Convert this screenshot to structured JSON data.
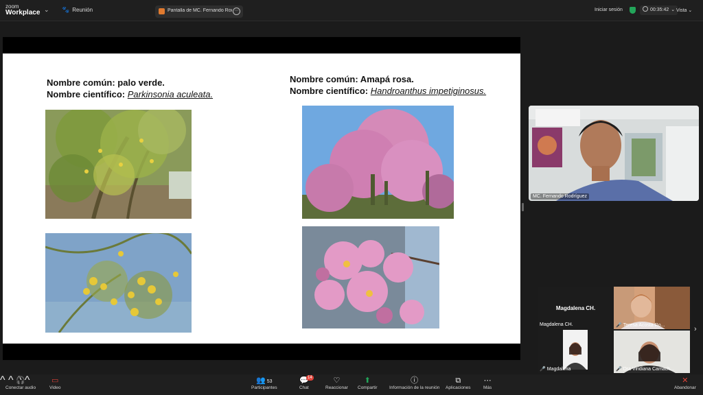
{
  "topbar": {
    "logo_line1": "zoom",
    "logo_line2": "Workplace",
    "meeting_label": "Reunión",
    "share_tab_label": "Pantalla de MC. Fernando Rodríg...",
    "signin_label": "Iniciar sesión",
    "timer": "00:35:42",
    "view_label": "Vista",
    "shield_color": "#23a55a"
  },
  "slide": {
    "left_common_prefix": "Nombre común: palo verde.",
    "left_sci_prefix": "Nombre científico: ",
    "left_sci_name": "Parkinsonia aculeata.",
    "right_common_prefix": "Nombre común: Amapá rosa.",
    "right_sci_prefix": "Nombre científico: ",
    "right_sci_name": "Handroanthus impetiginosus."
  },
  "speaker": {
    "name": "MC. Fernando Rodríguez"
  },
  "gallery": {
    "magda_big": "Magdalena CH.",
    "magda_small": "Magdalena CH.",
    "tile_magda_name": "Magdalena",
    "tile_teresa_name": "Teresa Acosta Ro...",
    "tile_viridiana_name": "Dra Viridiana Camach..."
  },
  "toolbar": {
    "audio": "Conectar audio",
    "video": "Video",
    "participants": "Participantes",
    "participants_count": "53",
    "chat": "Chat",
    "chat_badge": "14",
    "react": "Reaccionar",
    "share": "Compartir",
    "info": "Información de la reunión",
    "apps": "Aplicaciones",
    "more": "Más",
    "leave": "Abandonar",
    "share_color": "#23a55a",
    "badge_color": "#e0443a"
  }
}
